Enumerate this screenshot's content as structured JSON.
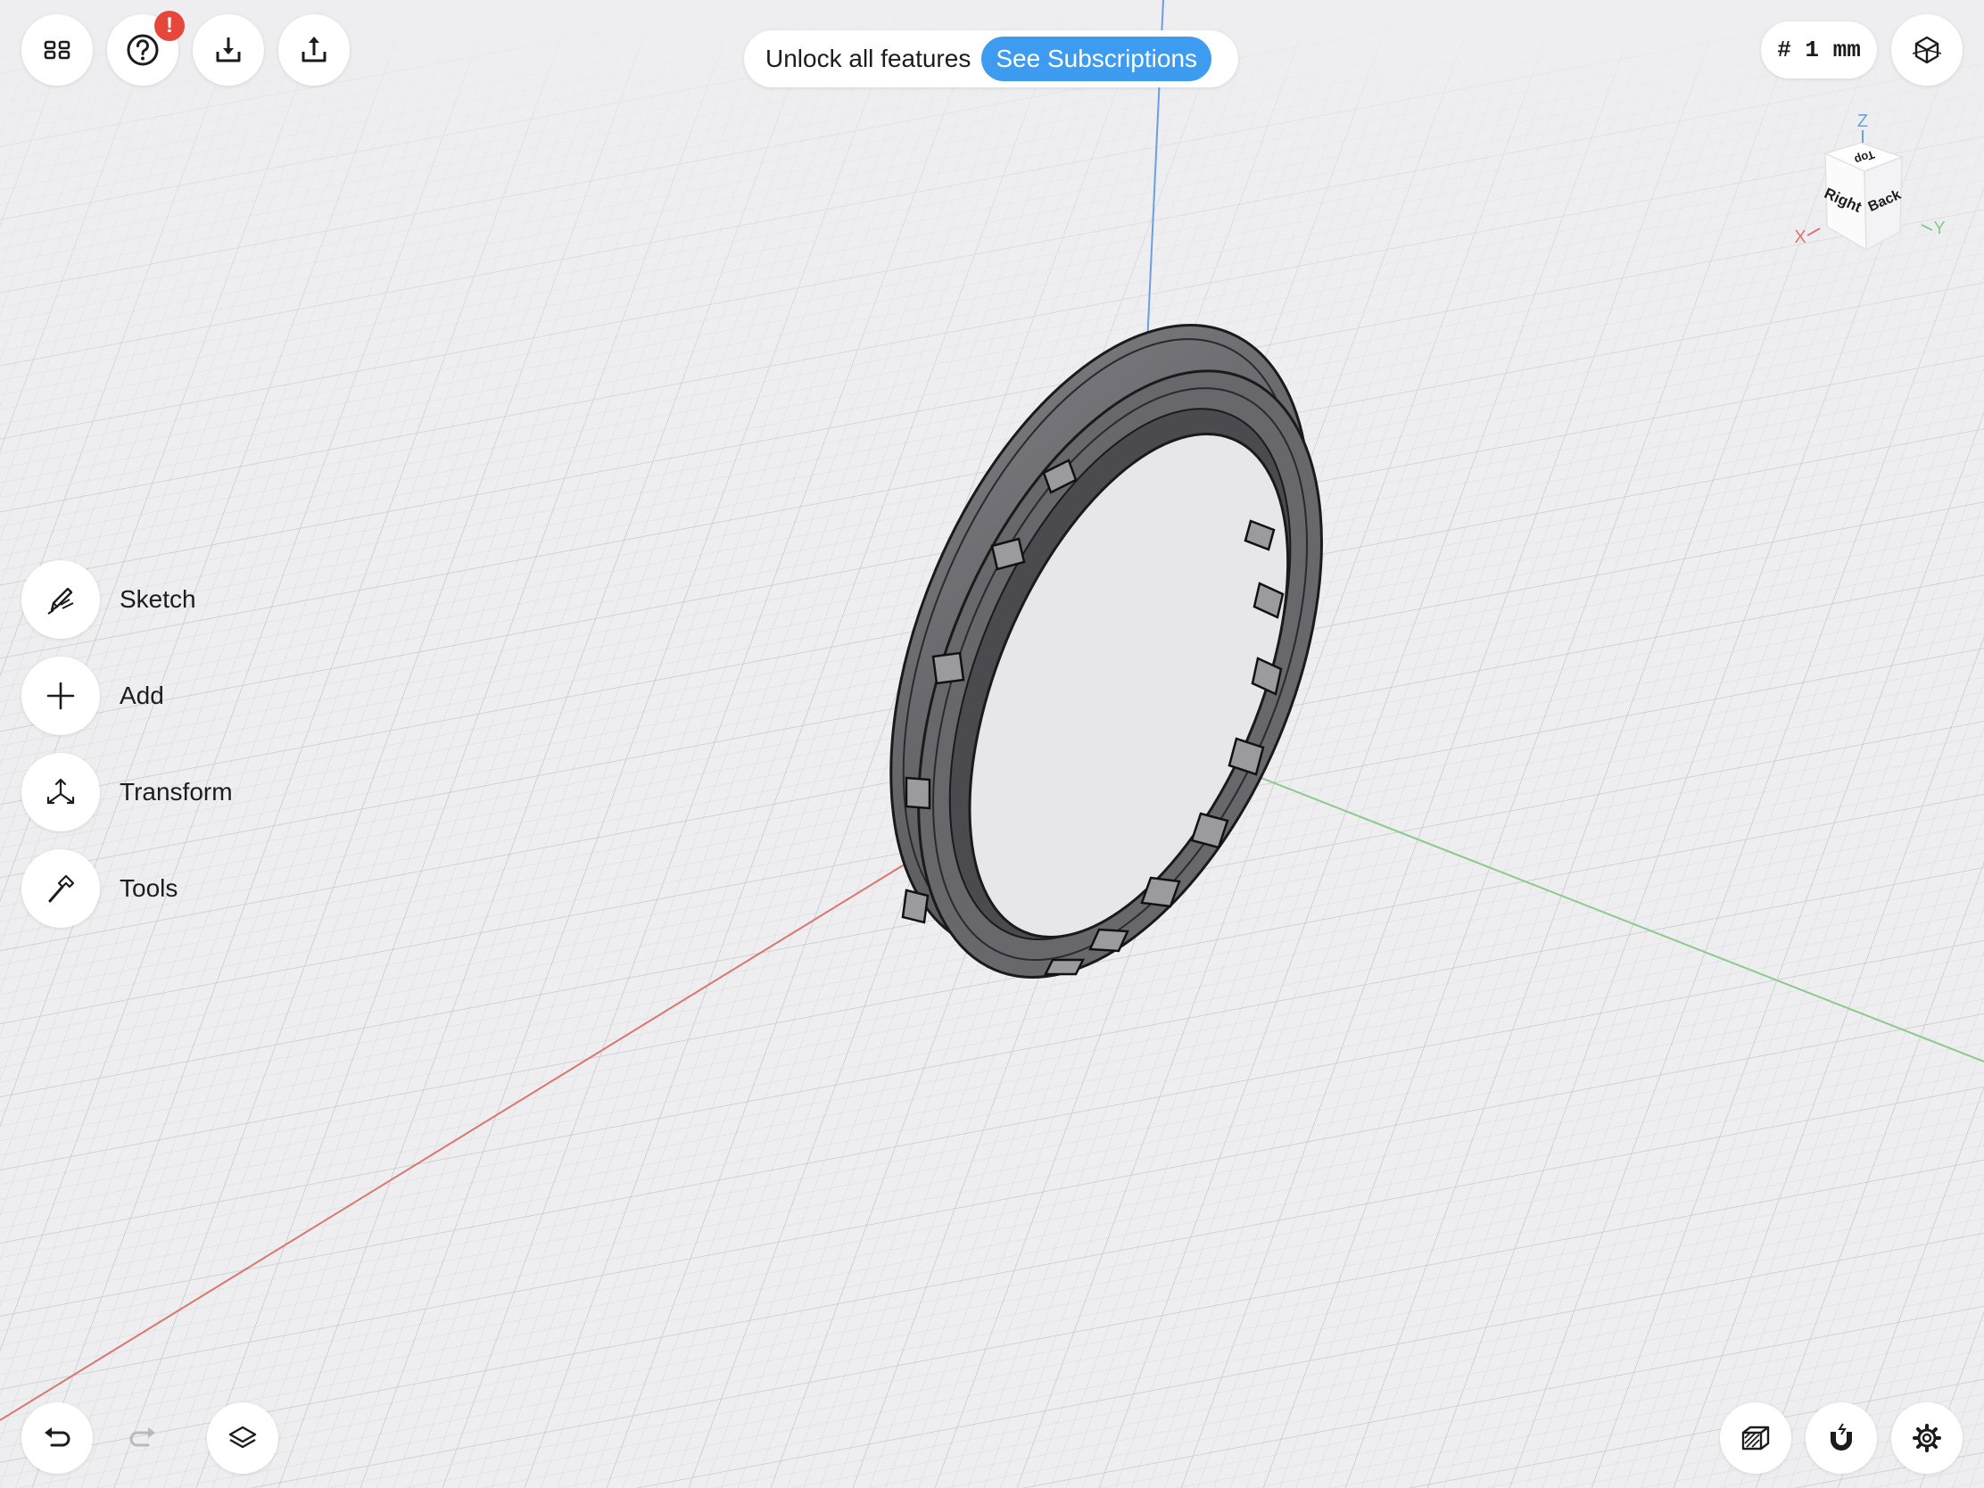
{
  "toolbar": {
    "menu_icon": "grid-icon",
    "help_icon": "question-icon",
    "alert_badge": "!",
    "import_icon": "download-icon",
    "export_icon": "share-icon"
  },
  "promo": {
    "text": "Unlock all features",
    "button_label": "See Subscriptions",
    "button_color": "#3d9cf0"
  },
  "grid_setting": {
    "label": "# 1 mm"
  },
  "view_cube": {
    "axis_z": "Z",
    "axis_x": "X",
    "axis_y": "Y",
    "face_top": "Top",
    "face_right": "Right",
    "face_back": "Back"
  },
  "tools": [
    {
      "label": "Sketch",
      "icon": "pencil-icon"
    },
    {
      "label": "Add",
      "icon": "plus-icon"
    },
    {
      "label": "Transform",
      "icon": "transform-arrows-icon"
    },
    {
      "label": "Tools",
      "icon": "hammer-icon"
    }
  ],
  "bottom_left": {
    "undo_icon": "undo-icon",
    "redo_icon": "redo-icon",
    "layers_icon": "layers-icon"
  },
  "bottom_right": {
    "section_icon": "section-view-icon",
    "snap_icon": "magnet-icon",
    "settings_icon": "gear-icon"
  },
  "colors": {
    "x_axis": "#d9776e",
    "y_axis": "#8cc98c",
    "z_axis": "#6a9fe0",
    "model": "#5d5d62",
    "alert": "#e5473b"
  }
}
